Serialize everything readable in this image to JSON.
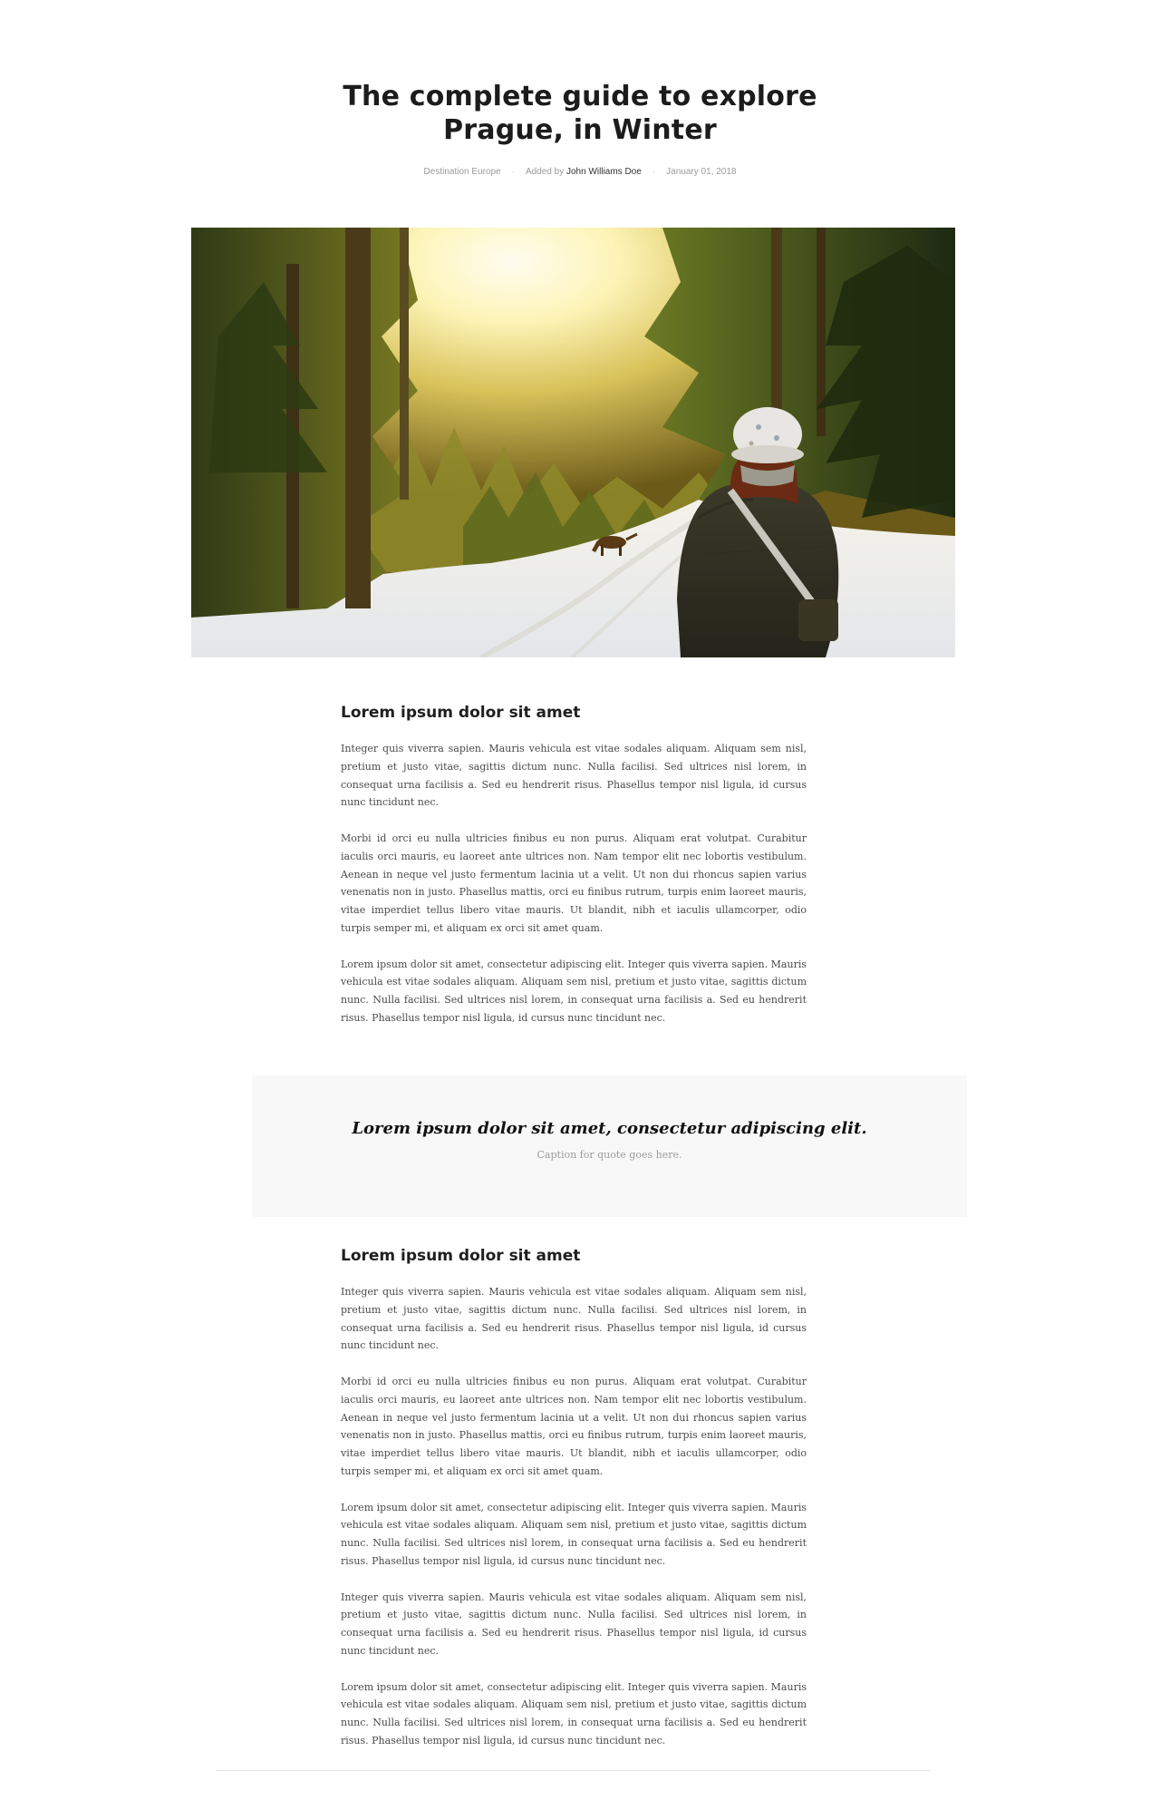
{
  "article": {
    "title": "The complete guide to explore Prague, in Winter",
    "meta": {
      "category": "Destination Europe",
      "added_by_prefix": "Added by",
      "author": "John Williams Doe",
      "date": "January 01, 2018",
      "separator": "·"
    },
    "hero_image": {
      "alt": ""
    },
    "sections": [
      {
        "heading": "Lorem ipsum dolor sit amet",
        "paragraphs": [
          "Integer quis viverra sapien. Mauris vehicula est vitae sodales aliquam. Aliquam sem nisl, pretium et justo vitae, sagittis dictum nunc. Nulla facilisi. Sed ultrices nisl lorem, in consequat urna facilisis a. Sed eu hendrerit risus. Phasellus tempor nisl ligula, id cursus nunc tincidunt nec.",
          "Morbi id orci eu nulla ultricies finibus eu non purus. Aliquam erat volutpat. Curabitur iaculis orci mauris, eu laoreet ante ultrices non. Nam tempor elit nec lobortis vestibulum. Aenean in neque vel justo fermentum lacinia ut a velit. Ut non dui rhoncus sapien varius venenatis non in justo. Phasellus mattis, orci eu finibus rutrum, turpis enim laoreet mauris, vitae imperdiet tellus libero vitae mauris. Ut blandit, nibh et iaculis ullamcorper, odio turpis semper mi, et aliquam ex orci sit amet quam.",
          "Lorem ipsum dolor sit amet, consectetur adipiscing elit. Integer quis viverra sapien. Mauris vehicula est vitae sodales aliquam. Aliquam sem nisl, pretium et justo vitae, sagittis dictum nunc. Nulla facilisi. Sed ultrices nisl lorem, in consequat urna facilisis a. Sed eu hendrerit risus. Phasellus tempor nisl ligula, id cursus nunc tincidunt nec."
        ]
      },
      {
        "heading": "Lorem ipsum dolor sit amet",
        "paragraphs": [
          "Integer quis viverra sapien. Mauris vehicula est vitae sodales aliquam. Aliquam sem nisl, pretium et justo vitae, sagittis dictum nunc. Nulla facilisi. Sed ultrices nisl lorem, in consequat urna facilisis a. Sed eu hendrerit risus. Phasellus tempor nisl ligula, id cursus nunc tincidunt nec.",
          "Morbi id orci eu nulla ultricies finibus eu non purus. Aliquam erat volutpat. Curabitur iaculis orci mauris, eu laoreet ante ultrices non. Nam tempor elit nec lobortis vestibulum. Aenean in neque vel justo fermentum lacinia ut a velit. Ut non dui rhoncus sapien varius venenatis non in justo. Phasellus mattis, orci eu finibus rutrum, turpis enim laoreet mauris, vitae imperdiet tellus libero vitae mauris. Ut blandit, nibh et iaculis ullamcorper, odio turpis semper mi, et aliquam ex orci sit amet quam.",
          "Lorem ipsum dolor sit amet, consectetur adipiscing elit. Integer quis viverra sapien. Mauris vehicula est vitae sodales aliquam. Aliquam sem nisl, pretium et justo vitae, sagittis dictum nunc. Nulla facilisi. Sed ultrices nisl lorem, in consequat urna facilisis a. Sed eu hendrerit risus. Phasellus tempor nisl ligula, id cursus nunc tincidunt nec.",
          "Integer quis viverra sapien. Mauris vehicula est vitae sodales aliquam. Aliquam sem nisl, pretium et justo vitae, sagittis dictum nunc. Nulla facilisi. Sed ultrices nisl lorem, in consequat urna facilisis a. Sed eu hendrerit risus. Phasellus tempor nisl ligula, id cursus nunc tincidunt nec.",
          "Lorem ipsum dolor sit amet, consectetur adipiscing elit. Integer quis viverra sapien. Mauris vehicula est vitae sodales aliquam. Aliquam sem nisl, pretium et justo vitae, sagittis dictum nunc. Nulla facilisi. Sed ultrices nisl lorem, in consequat urna facilisis a. Sed eu hendrerit risus. Phasellus tempor nisl ligula, id cursus nunc tincidunt nec."
        ]
      }
    ],
    "quote": {
      "text": "Lorem ipsum dolor sit amet, consectetur adipiscing elit.",
      "caption": "Caption for quote goes here."
    }
  },
  "colors": {
    "title": "#1c1c1c",
    "body_text": "#4a4a4a",
    "meta_text": "#9a9a9a",
    "quote_background": "#f8f8f8",
    "divider": "#e4e4e4"
  }
}
